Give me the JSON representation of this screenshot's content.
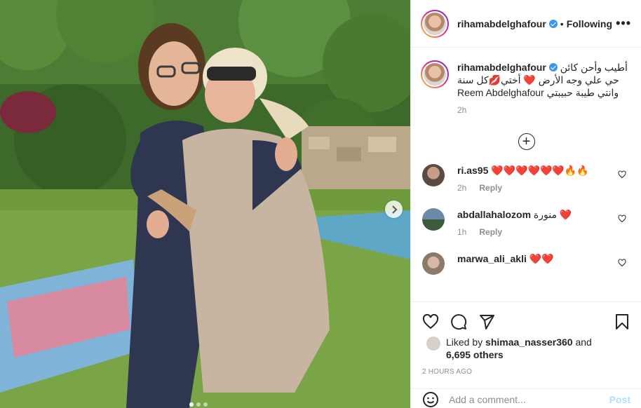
{
  "post": {
    "username": "rihamabdelghafour",
    "follow_state": "Following",
    "more_label": "•••",
    "separator": "•",
    "caption_text": "أطيب وأحن كائن حي علي وجه الأرض ❤️ أختي💋كل سنة وانتي طيبة حبيبتي Reem Abdelghafour",
    "caption_time": "2h",
    "load_more_label": "+",
    "comments": [
      {
        "username": "ri.as95",
        "text": "❤️❤️❤️❤️❤️❤️🔥🔥",
        "time": "2h",
        "reply": "Reply"
      },
      {
        "username": "abdallahalozom",
        "text": "منورة ❤️",
        "time": "1h",
        "reply": "Reply"
      },
      {
        "username": "marwa_ali_akli",
        "text": "❤️❤️",
        "time": "",
        "reply": ""
      }
    ],
    "liked_by_prefix": "Liked by",
    "liked_by_user": "shimaa_nasser360",
    "liked_by_and": "and",
    "liked_by_others": "6,695 others",
    "posted_ago": "2 HOURS AGO",
    "add_comment_placeholder": "Add a comment...",
    "post_button": "Post"
  },
  "carousel": {
    "slides": 3,
    "active": 0
  },
  "colors": {
    "accent": "#0095f6",
    "verified": "#3897f0",
    "post_disabled": "#b2dffc",
    "muted": "#8e8e8e",
    "heart": "#ed1c24"
  },
  "icons": [
    "verified-icon",
    "more-icon",
    "plus-circle-icon",
    "heart-outline-icon",
    "comment-icon",
    "share-icon",
    "bookmark-icon",
    "smiley-icon",
    "chevron-right-icon"
  ]
}
